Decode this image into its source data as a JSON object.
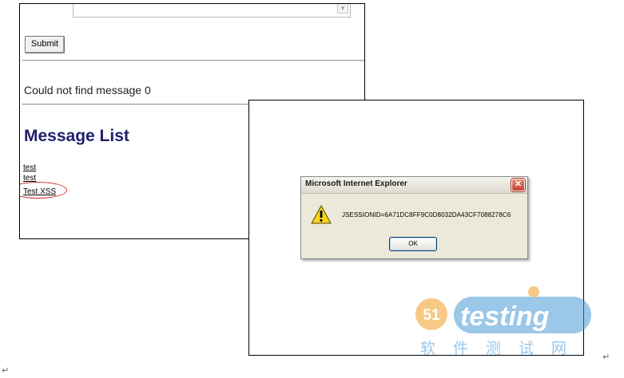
{
  "left_window": {
    "submit_label": "Submit",
    "status_message": "Could not find message 0",
    "list_title": "Message List",
    "messages": [
      "test",
      "test",
      "Test XSS"
    ]
  },
  "alert_dialog": {
    "title": "Microsoft Internet Explorer",
    "close_label": "✕",
    "icon": "warning-icon",
    "message": "JSESSIONID=6A71DC8FF9C0D8032DA43CF7088278C6",
    "ok_label": "OK"
  },
  "watermark": {
    "logo_number": "51",
    "logo_text": "testing",
    "chinese_text": "软件测试网"
  },
  "colors": {
    "highlight_circle": "#d03030",
    "list_title": "#1f1f6b",
    "dialog_bg": "#ece9d8",
    "watermark_blue": "#4a9ad6",
    "watermark_orange": "#f0a020"
  },
  "pilcrow": "↵"
}
